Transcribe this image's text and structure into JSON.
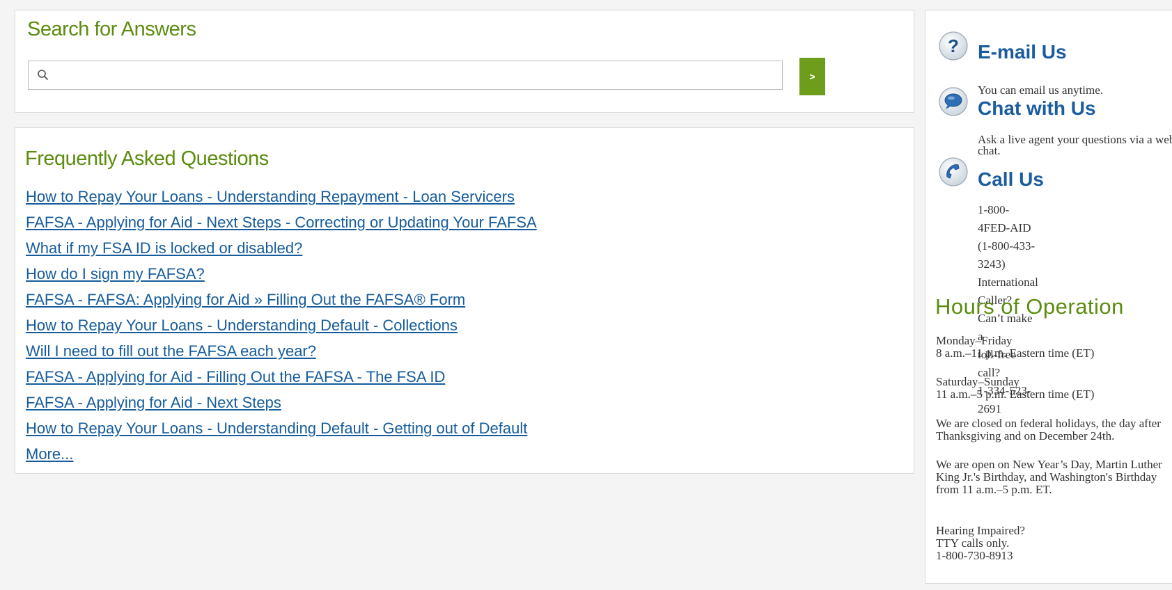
{
  "search": {
    "title": "Search for Answers",
    "placeholder": "",
    "value": "",
    "button_label": ">",
    "icon": "search-icon"
  },
  "faq": {
    "title": "Frequently Asked Questions",
    "links": [
      "How to Repay Your Loans - Understanding Repayment - Loan Servicers",
      "FAFSA - Applying for Aid - Next Steps - Correcting or Updating Your FAFSA",
      "What if my FSA ID is locked or disabled?",
      "How do I sign my FAFSA?",
      "FAFSA - FAFSA: Applying for Aid » Filling Out the FAFSA® Form",
      "How to Repay Your Loans - Understanding Default - Collections",
      "Will I need to fill out the FAFSA each year?",
      "FAFSA - Applying for Aid - Filling Out the FAFSA - The FSA ID",
      "FAFSA - Applying for Aid - Next Steps",
      "How to Repay Your Loans - Understanding Default - Getting out of Default"
    ],
    "more_label": "More..."
  },
  "contact": {
    "email": {
      "heading": "E-mail Us",
      "text": "You can email us anytime.",
      "icon": "question-mark-icon"
    },
    "chat": {
      "heading": "Chat with Us",
      "text": "Ask a live agent your questions via a web chat.",
      "icon": "chat-bubble-icon"
    },
    "call": {
      "heading": "Call Us",
      "lines": [
        "1-800-4FED-AID",
        "(1-800-433-3243)",
        "International Caller? Can’t make a",
        "toll-free call?",
        "1-334-523-2691"
      ],
      "icon": "phone-icon"
    }
  },
  "hours": {
    "title": "Hours of Operation",
    "weekday_days": "Monday–Friday",
    "weekday_time": "8 a.m.–11 p.m. Eastern time (ET)",
    "weekend_days": "Saturday–Sunday",
    "weekend_time": "11 a.m.–5 p.m. Eastern time (ET)",
    "closed_text": "We are closed on federal holidays, the day after Thanksgiving and on December 24th.",
    "open_text": "We are open on New Year’s Day, Martin Luther King Jr.'s Birthday, and Washington's Birthday from 11 a.m.–5 p.m. ET.",
    "hearing_title": "Hearing Impaired?",
    "hearing_tty": "TTY calls only.",
    "hearing_number": "1-800-730-8913"
  },
  "colors": {
    "green_title": "#5b8c0f",
    "link_blue": "#165c9b",
    "heading_blue": "#1a5c9e",
    "button_green": "#6e9c1b"
  }
}
